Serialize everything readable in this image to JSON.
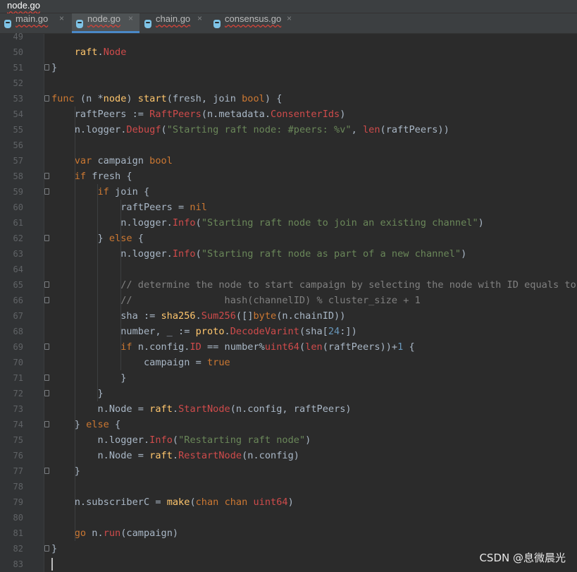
{
  "window": {
    "title": "node.go"
  },
  "tabs": [
    {
      "label": "main.go",
      "active": false,
      "icon": "go-file-icon",
      "close": "×"
    },
    {
      "label": "node.go",
      "active": true,
      "icon": "go-file-icon",
      "close": "×"
    },
    {
      "label": "chain.go",
      "active": false,
      "icon": "go-file-icon",
      "close": "×"
    },
    {
      "label": "consensus.go",
      "active": false,
      "icon": "go-file-icon",
      "close": "×"
    }
  ],
  "colors": {
    "background": "#2b2b2b",
    "keyword": "#cc7832",
    "field": "#9876aa",
    "method": "#ffc66d",
    "string": "#6a8759",
    "number": "#6897bb",
    "comment": "#808080",
    "plain": "#a9b7c6",
    "accent": "#4a88c7"
  },
  "editor": {
    "lines": [
      {
        "num": "49",
        "fold": false,
        "tokens": []
      },
      {
        "num": "50",
        "fold": false,
        "tokens": [
          [
            "plain",
            "    "
          ],
          [
            "method",
            "raft"
          ],
          [
            "plain",
            "."
          ],
          [
            "red",
            "Node"
          ]
        ]
      },
      {
        "num": "51",
        "fold": true,
        "tokens": [
          [
            "plain",
            "}"
          ]
        ]
      },
      {
        "num": "52",
        "fold": false,
        "tokens": []
      },
      {
        "num": "53",
        "fold": true,
        "tokens": [
          [
            "keyword",
            "func"
          ],
          [
            "plain",
            " (n *"
          ],
          [
            "method",
            "node"
          ],
          [
            "plain",
            ") "
          ],
          [
            "method",
            "start"
          ],
          [
            "plain",
            "(fresh, join "
          ],
          [
            "keyword",
            "bool"
          ],
          [
            "plain",
            ") {"
          ]
        ]
      },
      {
        "num": "54",
        "fold": false,
        "tokens": [
          [
            "plain",
            "    raftPeers := "
          ],
          [
            "red",
            "RaftPeers"
          ],
          [
            "plain",
            "(n.metadata."
          ],
          [
            "red",
            "ConsenterIds"
          ],
          [
            "plain",
            ")"
          ]
        ]
      },
      {
        "num": "55",
        "fold": false,
        "tokens": [
          [
            "plain",
            "    n.logger."
          ],
          [
            "red",
            "Debugf"
          ],
          [
            "plain",
            "("
          ],
          [
            "string",
            "\"Starting raft node: #peers: %v\""
          ],
          [
            "plain",
            ", "
          ],
          [
            "red",
            "len"
          ],
          [
            "plain",
            "(raftPeers))"
          ]
        ]
      },
      {
        "num": "56",
        "fold": false,
        "tokens": []
      },
      {
        "num": "57",
        "fold": false,
        "tokens": [
          [
            "plain",
            "    "
          ],
          [
            "keyword",
            "var"
          ],
          [
            "plain",
            " campaign "
          ],
          [
            "keyword",
            "bool"
          ]
        ]
      },
      {
        "num": "58",
        "fold": true,
        "tokens": [
          [
            "plain",
            "    "
          ],
          [
            "keyword",
            "if"
          ],
          [
            "plain",
            " fresh {"
          ]
        ]
      },
      {
        "num": "59",
        "fold": true,
        "tokens": [
          [
            "plain",
            "        "
          ],
          [
            "keyword",
            "if"
          ],
          [
            "plain",
            " join {"
          ]
        ]
      },
      {
        "num": "60",
        "fold": false,
        "tokens": [
          [
            "plain",
            "            raftPeers = "
          ],
          [
            "keyword",
            "nil"
          ]
        ]
      },
      {
        "num": "61",
        "fold": false,
        "tokens": [
          [
            "plain",
            "            n.logger."
          ],
          [
            "red",
            "Info"
          ],
          [
            "plain",
            "("
          ],
          [
            "string",
            "\"Starting raft node to join an existing channel\""
          ],
          [
            "plain",
            ")"
          ]
        ]
      },
      {
        "num": "62",
        "fold": true,
        "tokens": [
          [
            "plain",
            "        } "
          ],
          [
            "keyword",
            "else"
          ],
          [
            "plain",
            " {"
          ]
        ]
      },
      {
        "num": "63",
        "fold": false,
        "tokens": [
          [
            "plain",
            "            n.logger."
          ],
          [
            "red",
            "Info"
          ],
          [
            "plain",
            "("
          ],
          [
            "string",
            "\"Starting raft node as part of a new channel\""
          ],
          [
            "plain",
            ")"
          ]
        ]
      },
      {
        "num": "64",
        "fold": false,
        "tokens": []
      },
      {
        "num": "65",
        "fold": true,
        "tokens": [
          [
            "comment",
            "            // determine the node to start campaign by selecting the node with ID equals to:"
          ]
        ]
      },
      {
        "num": "66",
        "fold": true,
        "tokens": [
          [
            "comment",
            "            //                hash(channelID) % cluster_size + 1"
          ]
        ]
      },
      {
        "num": "67",
        "fold": false,
        "tokens": [
          [
            "plain",
            "            sha := "
          ],
          [
            "method",
            "sha256"
          ],
          [
            "plain",
            "."
          ],
          [
            "red",
            "Sum256"
          ],
          [
            "plain",
            "([]"
          ],
          [
            "keyword",
            "byte"
          ],
          [
            "plain",
            "(n.chainID))"
          ]
        ]
      },
      {
        "num": "68",
        "fold": false,
        "tokens": [
          [
            "plain",
            "            number, _ := "
          ],
          [
            "method",
            "proto"
          ],
          [
            "plain",
            "."
          ],
          [
            "red",
            "DecodeVarint"
          ],
          [
            "plain",
            "(sha["
          ],
          [
            "number",
            "24"
          ],
          [
            "plain",
            ":])"
          ]
        ]
      },
      {
        "num": "69",
        "fold": true,
        "tokens": [
          [
            "plain",
            "            "
          ],
          [
            "keyword",
            "if"
          ],
          [
            "plain",
            " n.config."
          ],
          [
            "red",
            "ID"
          ],
          [
            "plain",
            " == number%"
          ],
          [
            "red",
            "uint64"
          ],
          [
            "plain",
            "("
          ],
          [
            "red",
            "len"
          ],
          [
            "plain",
            "(raftPeers))+"
          ],
          [
            "number",
            "1"
          ],
          [
            "plain",
            " {"
          ]
        ]
      },
      {
        "num": "70",
        "fold": false,
        "tokens": [
          [
            "plain",
            "                campaign = "
          ],
          [
            "keyword",
            "true"
          ]
        ]
      },
      {
        "num": "71",
        "fold": true,
        "tokens": [
          [
            "plain",
            "            }"
          ]
        ]
      },
      {
        "num": "72",
        "fold": true,
        "tokens": [
          [
            "plain",
            "        }"
          ]
        ]
      },
      {
        "num": "73",
        "fold": false,
        "tokens": [
          [
            "plain",
            "        n.Node = "
          ],
          [
            "method",
            "raft"
          ],
          [
            "plain",
            "."
          ],
          [
            "red",
            "StartNode"
          ],
          [
            "plain",
            "(n.config, raftPeers)"
          ]
        ]
      },
      {
        "num": "74",
        "fold": true,
        "tokens": [
          [
            "plain",
            "    } "
          ],
          [
            "keyword",
            "else"
          ],
          [
            "plain",
            " {"
          ]
        ]
      },
      {
        "num": "75",
        "fold": false,
        "tokens": [
          [
            "plain",
            "        n.logger."
          ],
          [
            "red",
            "Info"
          ],
          [
            "plain",
            "("
          ],
          [
            "string",
            "\"Restarting raft node\""
          ],
          [
            "plain",
            ")"
          ]
        ]
      },
      {
        "num": "76",
        "fold": false,
        "tokens": [
          [
            "plain",
            "        n.Node = "
          ],
          [
            "method",
            "raft"
          ],
          [
            "plain",
            "."
          ],
          [
            "red",
            "RestartNode"
          ],
          [
            "plain",
            "(n.config)"
          ]
        ]
      },
      {
        "num": "77",
        "fold": true,
        "tokens": [
          [
            "plain",
            "    }"
          ]
        ]
      },
      {
        "num": "78",
        "fold": false,
        "tokens": []
      },
      {
        "num": "79",
        "fold": false,
        "tokens": [
          [
            "plain",
            "    n.subscriberC = "
          ],
          [
            "method",
            "make"
          ],
          [
            "plain",
            "("
          ],
          [
            "keyword",
            "chan"
          ],
          [
            "plain",
            " "
          ],
          [
            "keyword",
            "chan"
          ],
          [
            "plain",
            " "
          ],
          [
            "red",
            "uint64"
          ],
          [
            "plain",
            ")"
          ]
        ]
      },
      {
        "num": "80",
        "fold": false,
        "tokens": []
      },
      {
        "num": "81",
        "fold": false,
        "tokens": [
          [
            "plain",
            "    "
          ],
          [
            "keyword",
            "go"
          ],
          [
            "plain",
            " n."
          ],
          [
            "red",
            "run"
          ],
          [
            "plain",
            "(campaign)"
          ]
        ]
      },
      {
        "num": "82",
        "fold": true,
        "tokens": [
          [
            "plain",
            "}"
          ]
        ]
      },
      {
        "num": "83",
        "fold": false,
        "tokens": [],
        "cursor": true
      }
    ]
  },
  "watermark": "CSDN @息微晨光"
}
